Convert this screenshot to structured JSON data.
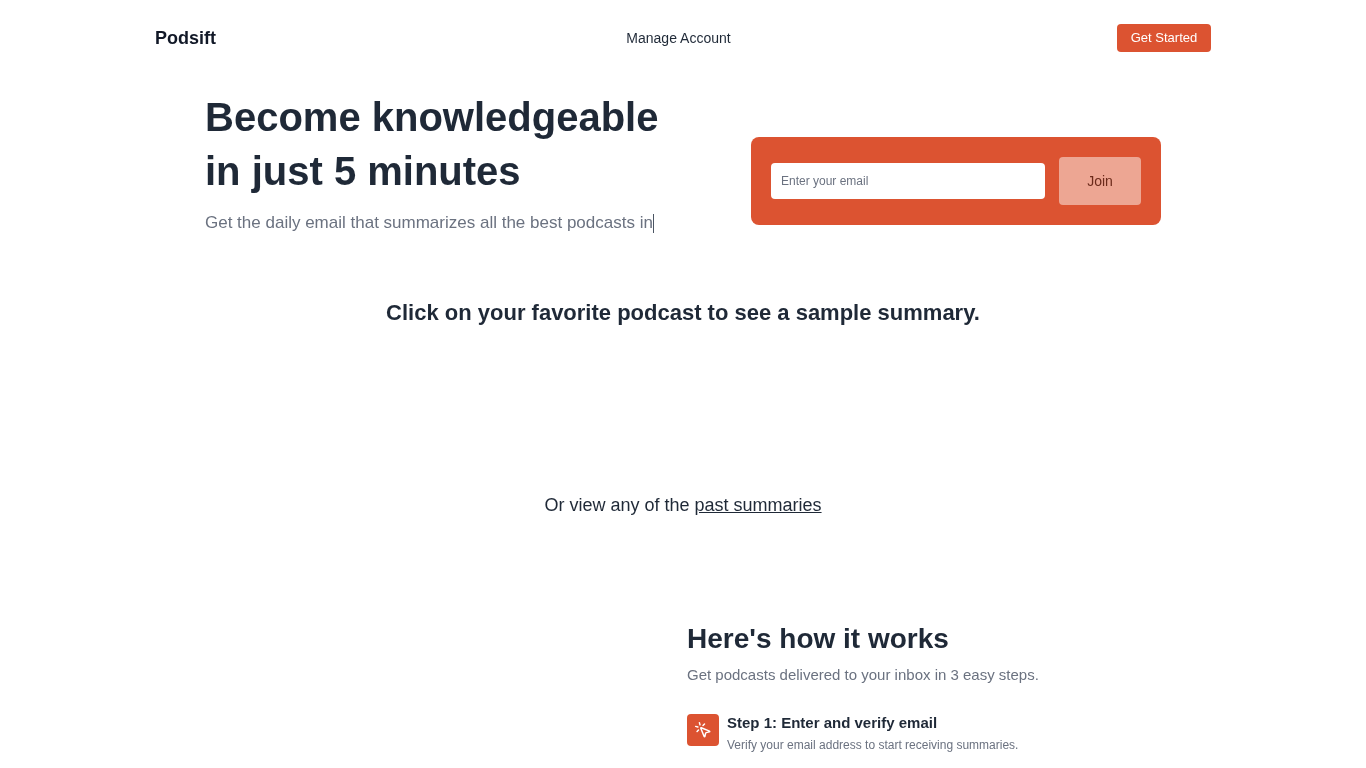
{
  "nav": {
    "logo": "Podsift",
    "links": [
      "Manage Account"
    ],
    "cta": "Get Started"
  },
  "hero": {
    "title": "Become knowledgeable in just 5 minutes",
    "subtitle": "Get the daily email that summarizes all the best podcasts in",
    "signup": {
      "placeholder": "Enter your email",
      "button": "Join"
    }
  },
  "samples": {
    "heading": "Click on your favorite podcast to see a sample summary.",
    "footer": {
      "text": "Or view any of the",
      "link": "past summaries"
    }
  },
  "how_it_works": {
    "title": "Here's how it works",
    "subtitle": "Get podcasts delivered to your inbox in 3 easy steps.",
    "steps": [
      {
        "title": "Step 1: Enter and verify email",
        "description": "Verify your email address to start receiving summaries."
      }
    ]
  }
}
